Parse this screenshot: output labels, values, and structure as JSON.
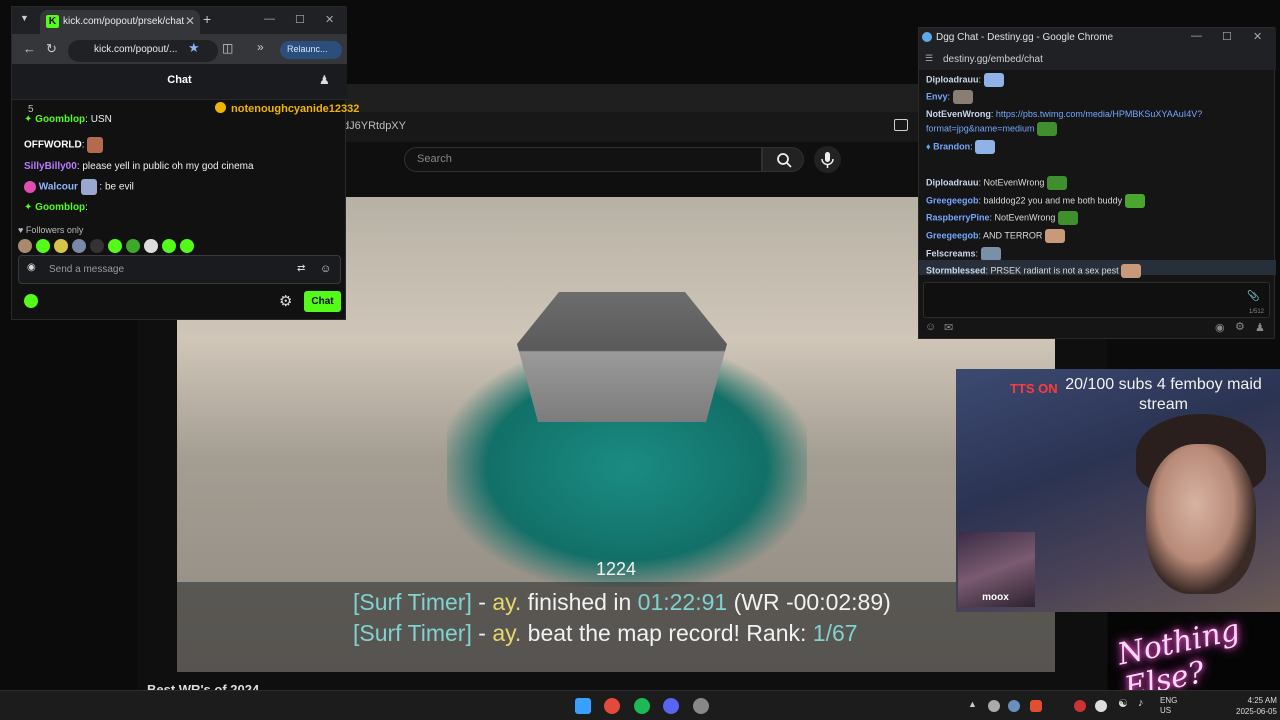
{
  "background_browser": {
    "url_partial": "dJ6YRtdpXY",
    "search_placeholder": "Search",
    "video": {
      "counter": "1224",
      "line1": {
        "tag": "[Surf Timer]",
        "dash": " - ",
        "player": "ay.",
        "text": " finished in ",
        "time": "01:22:91",
        "wr": " (WR -00:02:89)"
      },
      "line2": {
        "tag": "[Surf Timer]",
        "dash": " - ",
        "player": "ay.",
        "text": " beat the map record! Rank: ",
        "rank": "1/67"
      }
    },
    "below_video_title": "Best WR's of 2024"
  },
  "kick_window": {
    "tab_title": "kick.com/popout/prsek/chat",
    "url": "kick.com/popout/...",
    "relaunch_label": "Relaunc...",
    "header_title": "Chat",
    "pinned": {
      "number": "5",
      "user": "notenoughcyanide12332"
    },
    "messages": [
      {
        "user": "Goomblop",
        "text": ": USN",
        "color": "#53fc18"
      },
      {
        "user": "OFFWORLD",
        "text": ":",
        "color": "#ffffff"
      },
      {
        "user": "SillyBilly00",
        "text": ": please yell in public oh my god cinema",
        "color": "#b77bff"
      },
      {
        "user": "Walcour",
        "text": ": be evil",
        "color": "#8fb6ff"
      },
      {
        "user": "Goomblop",
        "text": ":",
        "color": "#53fc18"
      }
    ],
    "followers_only": "Followers only",
    "input_placeholder": "Send a message",
    "chat_button": "Chat"
  },
  "dgg_window": {
    "title": "Dgg Chat - Destiny.gg - Google Chrome",
    "url": "destiny.gg/embed/chat",
    "messages": [
      {
        "user": "Diploadrauu",
        "text": ":"
      },
      {
        "user": "Envy",
        "text": ":"
      },
      {
        "user": "NotEvenWrong",
        "text": ": ",
        "link": "https://pbs.twimg.com/media/HPMBKSuXYAAuI4V?"
      },
      {
        "user": "",
        "text": "",
        "link": "format=jpg&name=medium"
      },
      {
        "user": "Brandon",
        "text": ":"
      },
      {
        "user": "Diploadrauu",
        "text": ": NotEvenWrong"
      },
      {
        "user": "Greegeegob",
        "text": ": balddog22 you and me both buddy"
      },
      {
        "user": "RaspberryPine",
        "text": ": NotEvenWrong"
      },
      {
        "user": "Greegeegob",
        "text": ": AND TERROR"
      },
      {
        "user": "Felscreams",
        "text": ":"
      },
      {
        "user": "Stormblessed",
        "text": ": PRSEK radiant is not a sex pest"
      }
    ],
    "char_count": "1/512"
  },
  "webcam": {
    "subs_text": "20/100 subs 4 femboy maid stream",
    "tts_text": "TTS ON",
    "inset_label": "moox"
  },
  "neon_logo": {
    "text": "Nothing Else?"
  },
  "taskbar": {
    "lang_line1": "ENG",
    "lang_line2": "US",
    "time": "4:25 AM",
    "date": "2025-06-05"
  }
}
